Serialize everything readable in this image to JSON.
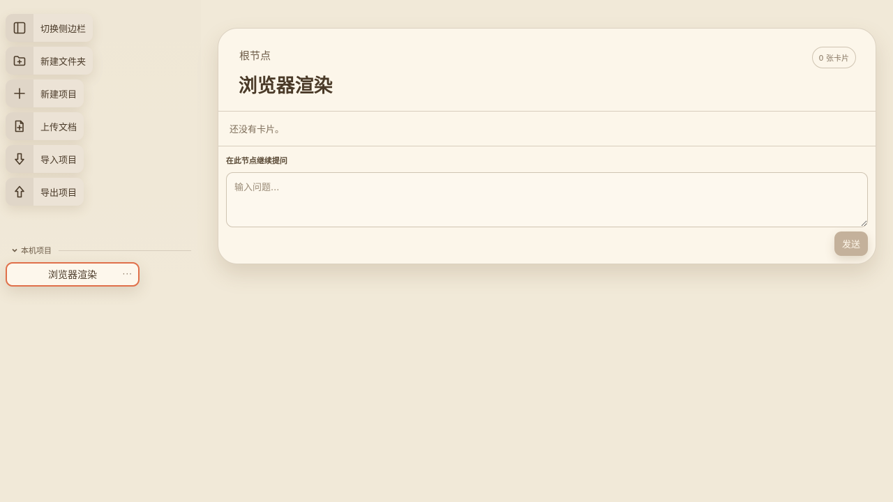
{
  "sidebar": {
    "actions": [
      {
        "label": "切换侧边栏",
        "icon": "sidebar-toggle-icon"
      },
      {
        "label": "新建文件夹",
        "icon": "folder-plus-icon"
      },
      {
        "label": "新建项目",
        "icon": "plus-icon"
      },
      {
        "label": "上传文档",
        "icon": "file-plus-icon"
      },
      {
        "label": "导入项目",
        "icon": "arrow-down-icon"
      },
      {
        "label": "导出项目",
        "icon": "arrow-up-icon"
      }
    ],
    "section_label": "本机项目",
    "projects": [
      {
        "name": "浏览器渲染",
        "more": "···"
      }
    ]
  },
  "main": {
    "breadcrumb": "根节点",
    "title": "浏览器渲染",
    "card_count": "0 张卡片",
    "empty_message": "还没有卡片。",
    "ask_label": "在此节点继续提问",
    "ask_placeholder": "输入问题...",
    "send_label": "发送"
  },
  "colors": {
    "background": "#f1e9d8",
    "card": "#fcf6ea",
    "accent_border": "#e0704a",
    "send_button": "#c4b19b",
    "text": "#4a3a28"
  }
}
